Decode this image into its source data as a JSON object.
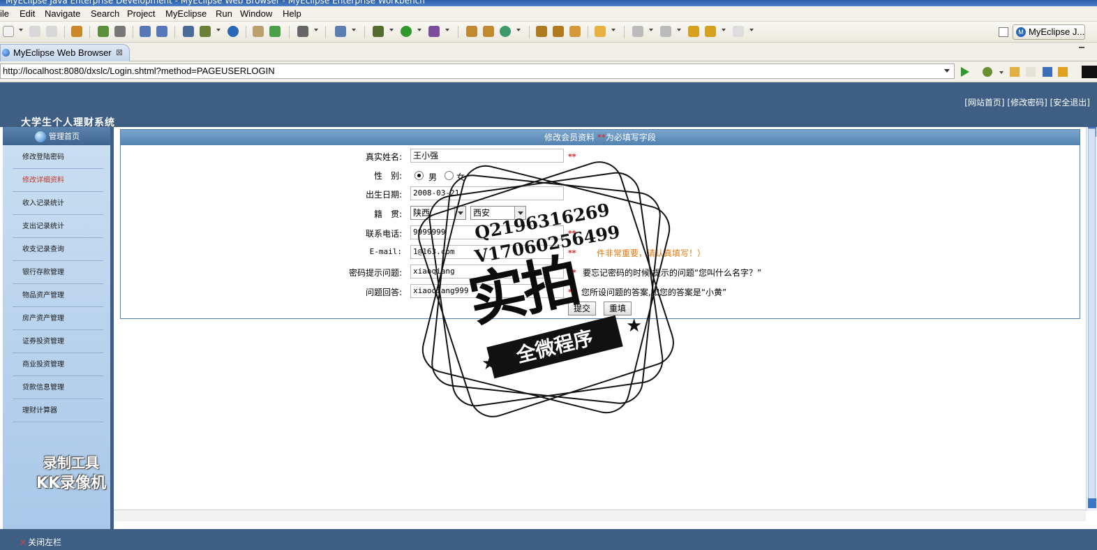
{
  "window": {
    "title": "MyEclipse Java Enterprise Development - MyEclipse Web Browser - MyEclipse Enterprise Workbench"
  },
  "menubar": {
    "items": [
      "ile",
      "Edit",
      "Navigate",
      "Search",
      "Project",
      "MyEclipse",
      "Run",
      "Window",
      "Help"
    ]
  },
  "toolbar": {
    "perspective_label": "MyEclipse J..."
  },
  "editor_tab": {
    "label": "MyEclipse Web Browser"
  },
  "address_bar": {
    "url": "http://localhost:8080/dxslc/Login.shtml?method=PAGEUSERLOGIN"
  },
  "site": {
    "title": "大学生个人理财系统",
    "top_links": [
      "[网站首页]",
      "[修改密码]",
      "[安全退出]"
    ],
    "left_head": "管理首页",
    "sidebar": [
      {
        "label": "修改登陆密码",
        "active": false
      },
      {
        "label": "修改详细资料",
        "active": true
      },
      {
        "label": "收入记录统计",
        "active": false
      },
      {
        "label": "支出记录统计",
        "active": false
      },
      {
        "label": "收支记录查询",
        "active": false
      },
      {
        "label": "银行存款管理",
        "active": false
      },
      {
        "label": "物品资产管理",
        "active": false
      },
      {
        "label": "房产资产管理",
        "active": false
      },
      {
        "label": "证券投资管理",
        "active": false
      },
      {
        "label": "商业投资管理",
        "active": false
      },
      {
        "label": "贷款信息管理",
        "active": false
      },
      {
        "label": "理财计算器",
        "active": false
      }
    ],
    "close_left": "关闭左栏"
  },
  "form": {
    "header_prefix": "修改会员资料 ",
    "header_stars": "**",
    "header_suffix": "为必填写字段",
    "real_name": {
      "label": "真实姓名:",
      "value": "王小强",
      "req": "**"
    },
    "gender": {
      "label": "性　别:",
      "male": "男",
      "female": "女",
      "selected": "男"
    },
    "birthday": {
      "label": "出生日期:",
      "value": "2008-03-21"
    },
    "native": {
      "label": "籍　贯:",
      "province": "陕西",
      "city": "西安"
    },
    "phone": {
      "label": "联系电话:",
      "value": "9999999",
      "req": "**"
    },
    "email": {
      "label": "E-mail:",
      "value": "1@163.com",
      "req": "**",
      "hint": "件非常重要，请认真填写！）"
    },
    "question": {
      "label": "密码提示问题:",
      "value": "xiaoqiang",
      "req": "**",
      "hint": "要忘记密码的时候,提示的问题“您叫什么名字？”"
    },
    "answer": {
      "label": "问题回答:",
      "value": "xiaoqiang999",
      "req": "**",
      "hint": "您所设问题的答案,如您的答案是“小黄”"
    },
    "submit": "提交",
    "reset": "重填"
  },
  "watermarks": {
    "recorder_line1": "录制工具",
    "recorder_line2": "KK录像机",
    "stamp_contact1": "Q2196316269",
    "stamp_contact2": "V17060256499",
    "stamp_big": "实拍",
    "stamp_banner": "全微程序"
  },
  "colors": {
    "header_blue": "#3e5f83",
    "required_red": "#e02020",
    "hint_orange": "#e07a10"
  }
}
